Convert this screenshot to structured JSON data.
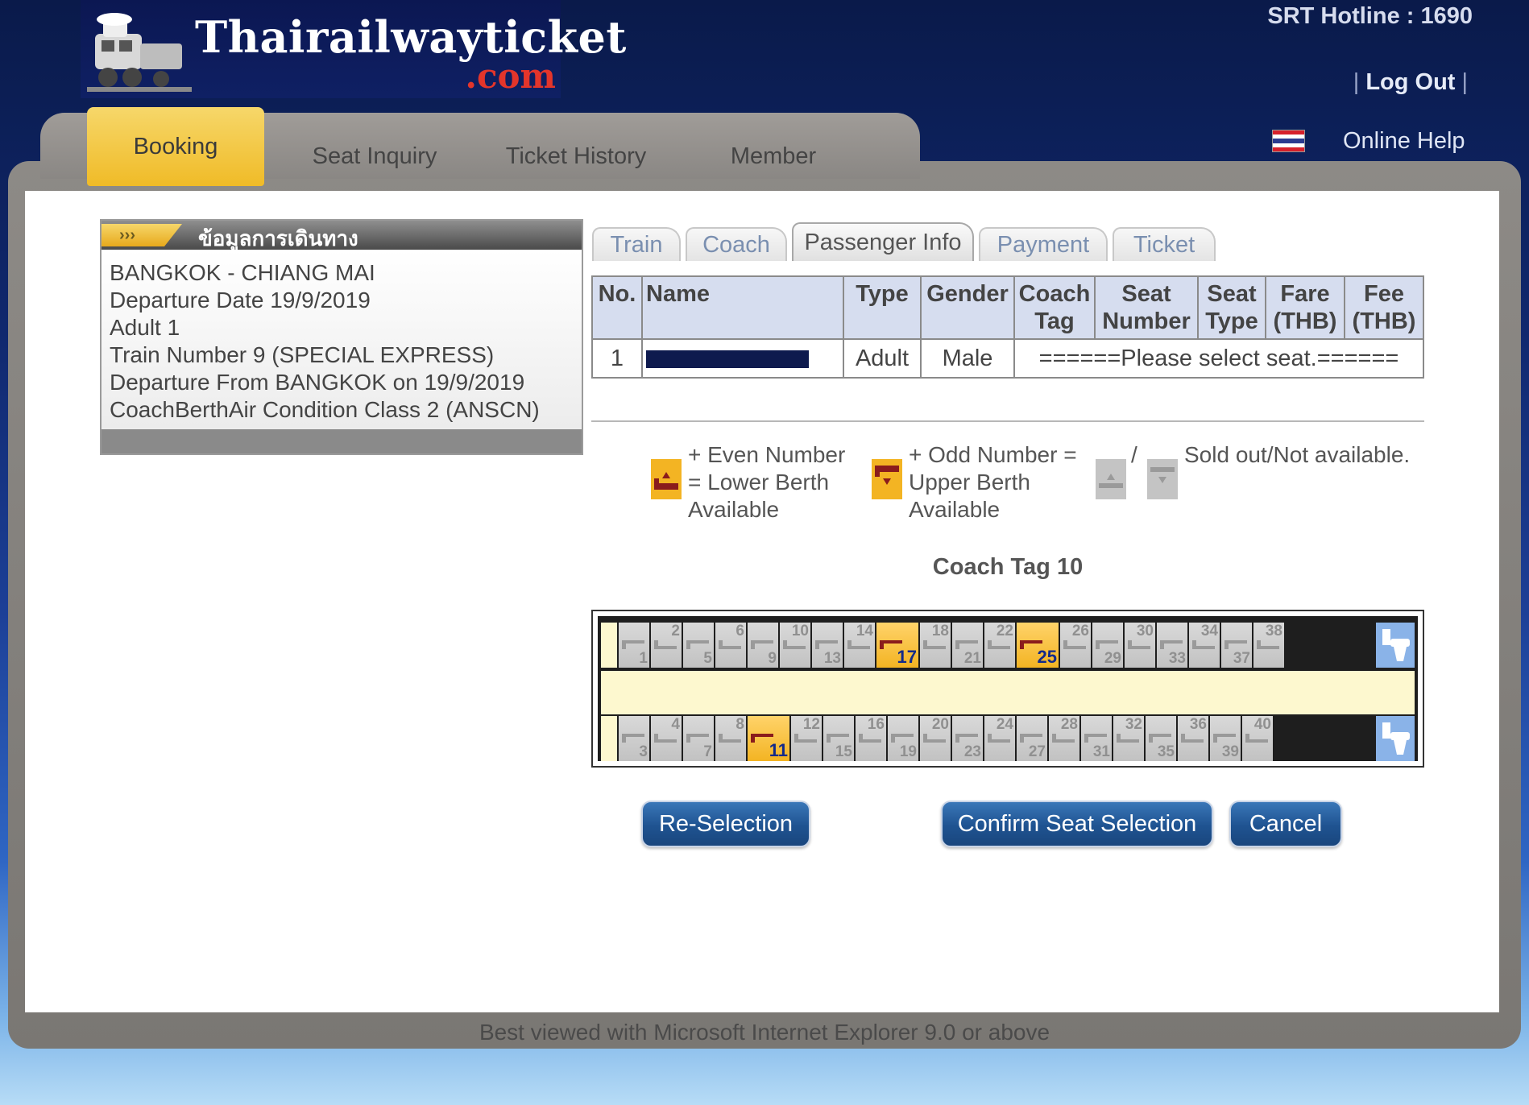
{
  "header": {
    "logo_title": "Thairailwayticket",
    "logo_sub": ".com",
    "hotline": "SRT Hotline : 1690",
    "logout": "Log Out",
    "online_help": "Online Help"
  },
  "nav": {
    "tabs": [
      {
        "label": "Booking",
        "active": true
      },
      {
        "label": "Seat Inquiry",
        "active": false
      },
      {
        "label": "Ticket History",
        "active": false
      },
      {
        "label": "Member",
        "active": false
      }
    ]
  },
  "trip": {
    "title": "ข้อมูลการเดินทาง",
    "arrows": "›››",
    "lines": [
      "BANGKOK - CHIANG MAI",
      "Departure Date 19/9/2019",
      "Adult 1",
      "Train Number 9 (SPECIAL EXPRESS)",
      "Departure From BANGKOK on 19/9/2019",
      "CoachBerthAir Condition Class 2 (ANSCN)"
    ]
  },
  "steps": {
    "tabs": [
      {
        "label": "Train",
        "active": false
      },
      {
        "label": "Coach",
        "active": false
      },
      {
        "label": "Passenger Info",
        "active": true
      },
      {
        "label": "Payment",
        "active": false
      },
      {
        "label": "Ticket",
        "active": false
      }
    ]
  },
  "passenger_table": {
    "headers": [
      "No.",
      "Name",
      "Type",
      "Gender",
      "Coach Tag",
      "Seat Number",
      "Seat Type",
      "Fare (THB)",
      "Fee (THB)"
    ],
    "rows": [
      {
        "no": "1",
        "type": "Adult",
        "gender": "Male",
        "message": "======Please select seat.======"
      }
    ]
  },
  "legend": {
    "even": "+ Even Number = Lower Berth Available",
    "odd": "+ Odd Number = Upper Berth Available",
    "slash": "/",
    "sold": "Sold out/Not available."
  },
  "coach": {
    "tag_label": "Coach Tag 10",
    "top_row": [
      {
        "up": "",
        "down": "1",
        "available": false
      },
      {
        "up": "2",
        "down": "",
        "available": false
      },
      {
        "up": "",
        "down": "5",
        "available": false
      },
      {
        "up": "6",
        "down": "",
        "available": false
      },
      {
        "up": "",
        "down": "9",
        "available": false
      },
      {
        "up": "10",
        "down": "",
        "available": false
      },
      {
        "up": "",
        "down": "13",
        "available": false
      },
      {
        "up": "14",
        "down": "",
        "available": false
      },
      {
        "up": "",
        "down": "17",
        "available": true
      },
      {
        "up": "18",
        "down": "",
        "available": false
      },
      {
        "up": "",
        "down": "21",
        "available": false
      },
      {
        "up": "22",
        "down": "",
        "available": false
      },
      {
        "up": "",
        "down": "25",
        "available": true
      },
      {
        "up": "26",
        "down": "",
        "available": false
      },
      {
        "up": "",
        "down": "29",
        "available": false
      },
      {
        "up": "30",
        "down": "",
        "available": false
      },
      {
        "up": "",
        "down": "33",
        "available": false
      },
      {
        "up": "34",
        "down": "",
        "available": false
      },
      {
        "up": "",
        "down": "37",
        "available": false
      },
      {
        "up": "38",
        "down": "",
        "available": false
      }
    ],
    "bottom_row": [
      {
        "up": "",
        "down": "3",
        "available": false
      },
      {
        "up": "4",
        "down": "",
        "available": false
      },
      {
        "up": "",
        "down": "7",
        "available": false
      },
      {
        "up": "8",
        "down": "",
        "available": false
      },
      {
        "up": "",
        "down": "11",
        "available": true
      },
      {
        "up": "12",
        "down": "",
        "available": false
      },
      {
        "up": "",
        "down": "15",
        "available": false
      },
      {
        "up": "16",
        "down": "",
        "available": false
      },
      {
        "up": "",
        "down": "19",
        "available": false
      },
      {
        "up": "20",
        "down": "",
        "available": false
      },
      {
        "up": "",
        "down": "23",
        "available": false
      },
      {
        "up": "24",
        "down": "",
        "available": false
      },
      {
        "up": "",
        "down": "27",
        "available": false
      },
      {
        "up": "28",
        "down": "",
        "available": false
      },
      {
        "up": "",
        "down": "31",
        "available": false
      },
      {
        "up": "32",
        "down": "",
        "available": false
      },
      {
        "up": "",
        "down": "35",
        "available": false
      },
      {
        "up": "36",
        "down": "",
        "available": false
      },
      {
        "up": "",
        "down": "39",
        "available": false
      },
      {
        "up": "40",
        "down": "",
        "available": false
      }
    ]
  },
  "buttons": {
    "reselect": "Re-Selection",
    "confirm": "Confirm Seat Selection",
    "cancel": "Cancel"
  },
  "footer": "Best viewed with Microsoft Internet Explorer 9.0 or above",
  "colors": {
    "accent_yellow": "#f0bb27",
    "button_blue": "#1f5391",
    "header_blue": "#0f2064",
    "logo_red": "#e3352b"
  }
}
